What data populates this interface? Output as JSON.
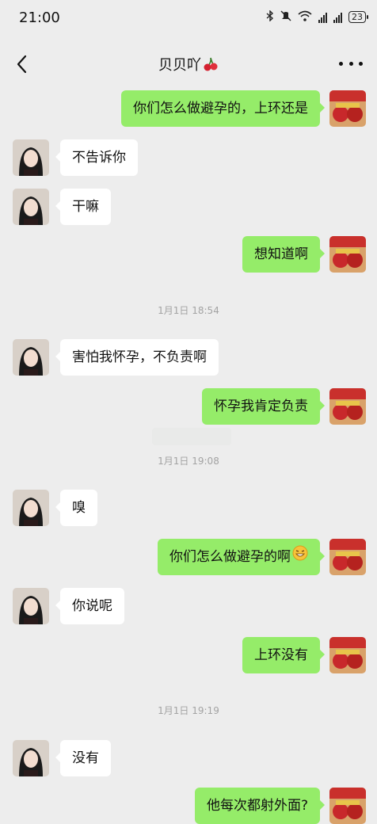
{
  "status_bar": {
    "time": "21:00",
    "battery": "23"
  },
  "header": {
    "title": "贝贝吖"
  },
  "messages": [
    {
      "type": "out",
      "text": "你们怎么做避孕的，上环还是"
    },
    {
      "type": "in",
      "text": "不告诉你"
    },
    {
      "type": "in",
      "text": "干嘛"
    },
    {
      "type": "out",
      "text": "想知道啊"
    },
    {
      "type": "time",
      "text": "1月1日 18:54"
    },
    {
      "type": "in",
      "text": "害怕我怀孕，不负责啊"
    },
    {
      "type": "out",
      "text": "怀孕我肯定负责"
    },
    {
      "type": "time",
      "text": "1月1日 19:08"
    },
    {
      "type": "in",
      "text": "嗅"
    },
    {
      "type": "out",
      "text": "你们怎么做避孕的啊"
    },
    {
      "type": "in",
      "text": "你说呢"
    },
    {
      "type": "out",
      "text": "上环没有"
    },
    {
      "type": "time",
      "text": "1月1日 19:19"
    },
    {
      "type": "in",
      "text": "没有"
    },
    {
      "type": "out",
      "text": "他每次都射外面?"
    }
  ],
  "colors": {
    "background": "#ededed",
    "outgoing_bubble": "#95ec69",
    "incoming_bubble": "#ffffff"
  },
  "icons": [
    "back-arrow-icon",
    "more-icon",
    "cherry-emoji",
    "grin-emoji",
    "bluetooth-icon",
    "mute-icon",
    "wifi-icon",
    "signal-icon",
    "battery-icon"
  ]
}
